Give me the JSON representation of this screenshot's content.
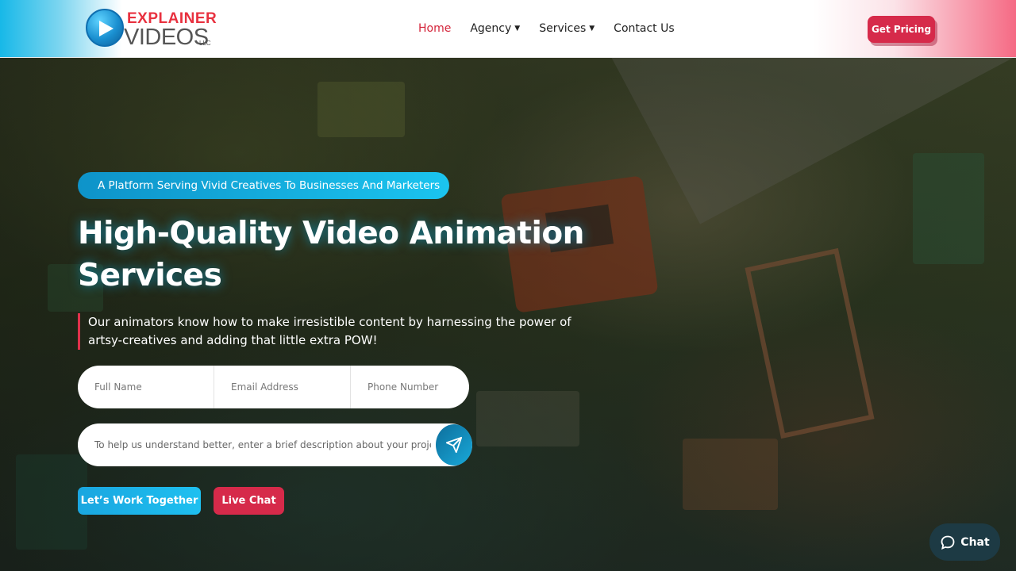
{
  "header": {
    "logo_top": "EXPLAINER",
    "logo_bottom": "VIDEOS",
    "logo_suffix": "LLC",
    "nav": [
      {
        "label": "Home",
        "active": true
      },
      {
        "label": "Agency",
        "has_dropdown": true
      },
      {
        "label": "Services",
        "has_dropdown": true
      },
      {
        "label": "Contact Us"
      }
    ],
    "cta_label": "Get Pricing"
  },
  "hero": {
    "tagline": "A Platform Serving Vivid Creatives To Businesses And Marketers",
    "headline": "High-Quality Video Animation Services",
    "subtext": "Our animators know how to make irresistible content by harnessing the power of artsy-creatives and adding that little extra POW!",
    "form": {
      "full_name_placeholder": "Full Name",
      "email_placeholder": "Email Address",
      "phone_placeholder": "Phone Number",
      "description_placeholder": "To help us understand better, enter a brief description about your project."
    },
    "primary_button": "Let’s Work Together",
    "secondary_button": "Live Chat"
  },
  "chat_widget": {
    "label": "Chat",
    "icon": "chat-bubble-icon"
  },
  "colors": {
    "accent_red": "#d62a4a",
    "accent_blue": "#1aa6e0",
    "nav_active": "#d4243a"
  }
}
